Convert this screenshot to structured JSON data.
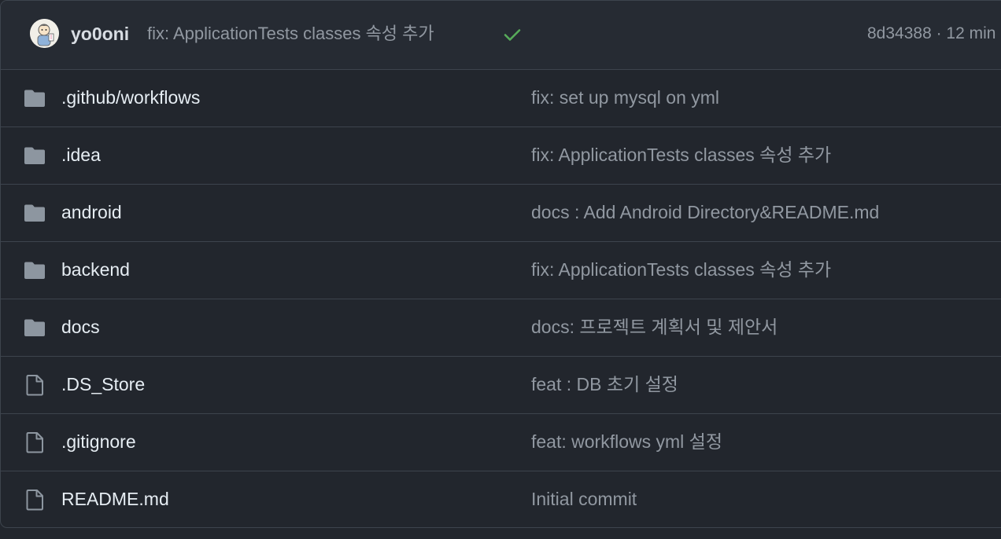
{
  "latest_commit": {
    "author": "yo0oni",
    "message": "fix: ApplicationTests classes 속성 추가",
    "status_icon": "check-icon",
    "status_color": "#57ab5a",
    "meta": "8d34388 · 12 min"
  },
  "files": [
    {
      "type": "folder",
      "icon": "folder-icon",
      "name": ".github/workflows",
      "commit": "fix: set up mysql on yml"
    },
    {
      "type": "folder",
      "icon": "folder-icon",
      "name": ".idea",
      "commit": "fix: ApplicationTests classes 속성 추가"
    },
    {
      "type": "folder",
      "icon": "folder-icon",
      "name": "android",
      "commit": "docs : Add Android Directory&README.md"
    },
    {
      "type": "folder",
      "icon": "folder-icon",
      "name": "backend",
      "commit": "fix: ApplicationTests classes 속성 추가"
    },
    {
      "type": "folder",
      "icon": "folder-icon",
      "name": "docs",
      "commit": "docs: 프로젝트 계획서 및 제안서"
    },
    {
      "type": "file",
      "icon": "file-icon",
      "name": ".DS_Store",
      "commit": "feat : DB 초기 설정"
    },
    {
      "type": "file",
      "icon": "file-icon",
      "name": ".gitignore",
      "commit": "feat: workflows yml 설정"
    },
    {
      "type": "file",
      "icon": "file-icon",
      "name": "README.md",
      "commit": "Initial commit"
    }
  ],
  "colors": {
    "background": "#22262d",
    "header_background": "#262b33",
    "border": "#3d444d",
    "text_primary": "#e6edf3",
    "text_muted": "#9198a1",
    "folder_icon": "#8d96a0"
  }
}
